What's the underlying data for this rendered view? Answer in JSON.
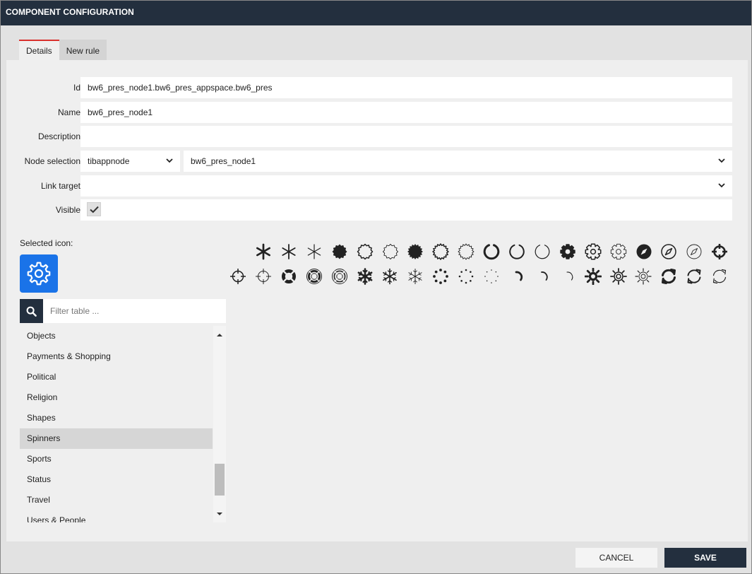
{
  "window": {
    "title": "COMPONENT CONFIGURATION"
  },
  "tabs": [
    {
      "label": "Details",
      "active": true
    },
    {
      "label": "New rule",
      "active": false
    }
  ],
  "form": {
    "id": {
      "label": "Id",
      "value": "bw6_pres_node1.bw6_pres_appspace.bw6_pres"
    },
    "name": {
      "label": "Name",
      "value": "bw6_pres_node1"
    },
    "description": {
      "label": "Description",
      "value": ""
    },
    "node_selection": {
      "label": "Node selection",
      "type_value": "tibappnode",
      "node_value": "bw6_pres_node1"
    },
    "link_target": {
      "label": "Link target",
      "value": ""
    },
    "visible": {
      "label": "Visible",
      "checked": true
    }
  },
  "icon_picker": {
    "selected_label": "Selected icon:",
    "selected_icon": "gear-icon",
    "filter_placeholder": "Filter table ...",
    "categories": [
      "Objects",
      "Payments & Shopping",
      "Political",
      "Religion",
      "Shapes",
      "Spinners",
      "Sports",
      "Status",
      "Travel",
      "Users & People"
    ],
    "selected_category": "Spinners",
    "icons": [
      "asterisk-bold-icon",
      "asterisk-icon",
      "asterisk-thin-icon",
      "badge-solid-icon",
      "badge-icon",
      "badge-thin-icon",
      "certificate-solid-icon",
      "certificate-icon",
      "certificate-thin-icon",
      "circle-notch-bold-icon",
      "circle-notch-icon",
      "circle-notch-thin-icon",
      "cog-solid-icon",
      "cog-icon",
      "cog-thin-icon",
      "compass-solid-icon",
      "compass-icon",
      "compass-thin-icon",
      "crosshairs-bold-icon",
      "crosshairs-icon",
      "crosshairs-thin-icon",
      "life-ring-solid-icon",
      "life-ring-icon",
      "life-ring-thin-icon",
      "snowflake-bold-icon",
      "snowflake-icon",
      "snowflake-thin-icon",
      "spinner-bold-icon",
      "spinner-icon",
      "spinner-thin-icon",
      "spinner-third-bold-icon",
      "spinner-third-icon",
      "spinner-third-thin-icon",
      "sun-solid-icon",
      "sun-icon",
      "sun-thin-icon",
      "sync-bold-icon",
      "sync-icon",
      "sync-thin-icon"
    ]
  },
  "footer": {
    "cancel_label": "CANCEL",
    "save_label": "SAVE"
  },
  "colors": {
    "header": "#232f3e",
    "accent": "#d9302c",
    "selected_icon_bg": "#1a73e8"
  }
}
